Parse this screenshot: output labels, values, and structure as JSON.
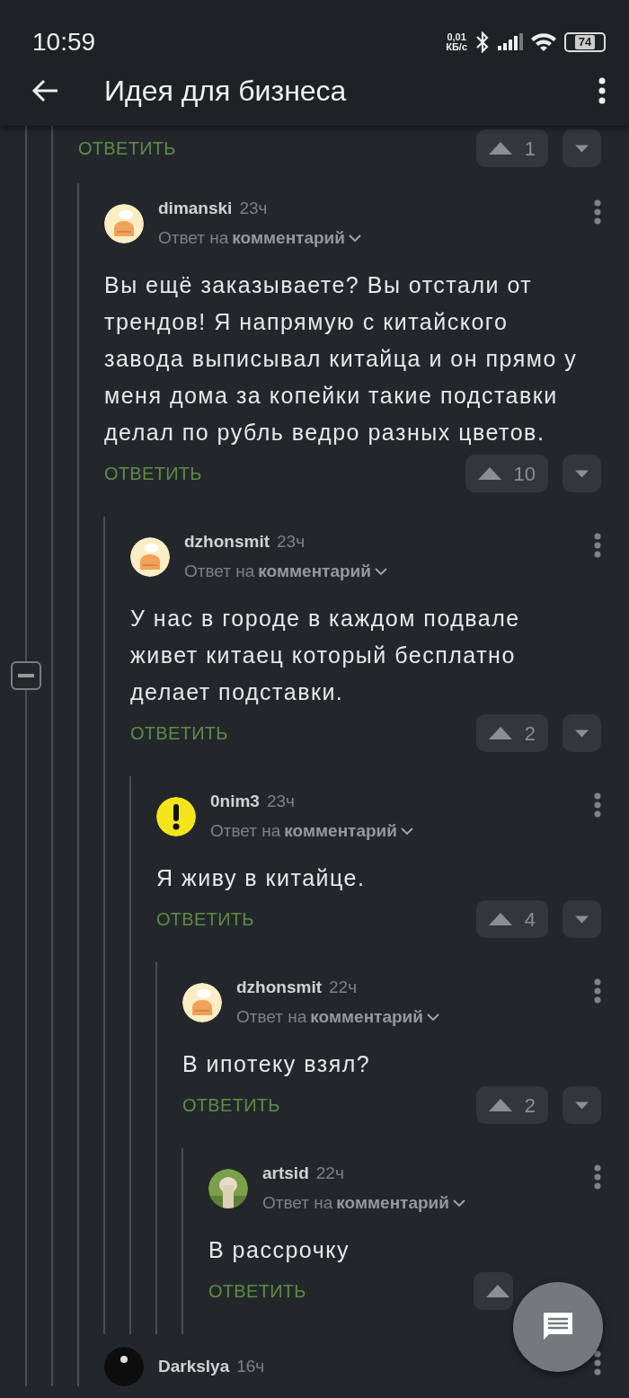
{
  "status_bar": {
    "time": "10:59",
    "net_speed": "0,01",
    "net_unit": "КБ/с",
    "battery": "74"
  },
  "header": {
    "title": "Идея для бизнеса"
  },
  "thread": {
    "collapsed": false,
    "comments": [
      {
        "reply": "ОТВЕТИТЬ",
        "votes": "1",
        "children": [
          {
            "kind": "chef",
            "author": "dimanski",
            "time": "23ч",
            "reply_prefix": "Ответ на",
            "reply_target": "комментарий",
            "text": "Вы ещё заказываете? Вы отстали от трендов! Я напрямую с китайского завода выписывал китайца и он прямо у меня дома за копейки такие подставки делал по рубль ведро разных цветов.",
            "reply": "ОТВЕТИТЬ",
            "votes": "10",
            "children": [
              {
                "kind": "chef",
                "author": "dzhonsmit",
                "time": "23ч",
                "reply_prefix": "Ответ на",
                "reply_target": "комментарий",
                "text": "У нас в городе в каждом подвале живет китаец который бесплатно делает подставки.",
                "reply": "ОТВЕТИТЬ",
                "votes": "2",
                "children": [
                  {
                    "kind": "warning",
                    "author": "0nim3",
                    "time": "23ч",
                    "reply_prefix": "Ответ на",
                    "reply_target": "комментарий",
                    "text": "Я живу в китайце.",
                    "reply": "ОТВЕТИТЬ",
                    "votes": "4",
                    "children": [
                      {
                        "kind": "chef",
                        "author": "dzhonsmit",
                        "time": "22ч",
                        "reply_prefix": "Ответ на",
                        "reply_target": "комментарий",
                        "text": "В ипотеку взял?",
                        "reply": "ОТВЕТИТЬ",
                        "votes": "2",
                        "children": [
                          {
                            "kind": "picture",
                            "author": "artsid",
                            "time": "22ч",
                            "reply_prefix": "Ответ на",
                            "reply_target": "комментарий",
                            "text": "В рассрочку",
                            "reply": "ОТВЕТИТЬ"
                          }
                        ]
                      }
                    ]
                  }
                ]
              }
            ]
          },
          {
            "kind": "dark",
            "author": "Darkslya",
            "time": "16ч"
          }
        ]
      }
    ]
  }
}
